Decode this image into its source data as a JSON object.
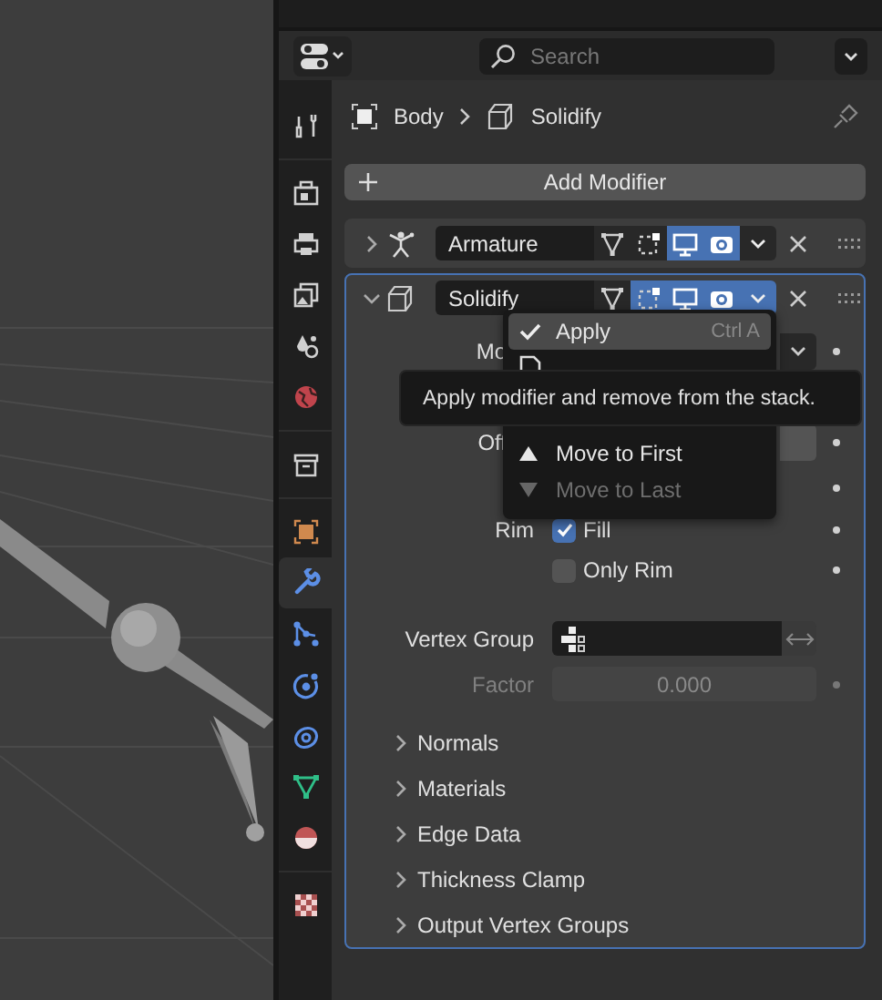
{
  "header": {
    "search": {
      "placeholder": "Search"
    }
  },
  "tab_groups": [
    {
      "tabs": [
        {
          "selected": false
        }
      ]
    },
    {
      "tabs": [
        {
          "selected": false
        },
        {
          "selected": false
        },
        {
          "selected": false
        },
        {
          "selected": false
        },
        {
          "selected": false
        }
      ]
    },
    {
      "tabs": [
        {
          "selected": false
        }
      ]
    },
    {
      "tabs": [
        {
          "selected": false
        },
        {
          "selected": true
        },
        {
          "selected": false
        },
        {
          "selected": false
        },
        {
          "selected": false
        },
        {
          "selected": false
        },
        {
          "selected": false
        }
      ]
    },
    {
      "tabs": [
        {
          "selected": false
        }
      ]
    }
  ],
  "breadcrumb": [
    {
      "label": "Body"
    },
    {
      "label": "Solidify"
    }
  ],
  "add_modifier": "Add Modifier",
  "modifiers": [
    {
      "name": "Armature",
      "kind": "armature",
      "expanded": false,
      "menu_open": false,
      "toggles": [
        {
          "on": false
        },
        {
          "on": false
        },
        {
          "on": true
        },
        {
          "on": true
        }
      ]
    },
    {
      "name": "Solidify",
      "kind": "solidify",
      "expanded": true,
      "menu_open": true,
      "toggles": [
        {
          "on": false
        },
        {
          "on": true
        },
        {
          "on": true
        },
        {
          "on": true
        }
      ],
      "rows": [
        {
          "kind": "dropdown",
          "label": "Mo"
        },
        {
          "kind": "field",
          "label": "Off"
        },
        {
          "kind": "covered"
        },
        {
          "kind": "checkbox",
          "label": "Rim",
          "text": "Fill",
          "checked": true
        },
        {
          "kind": "checkbox",
          "text": "Only Rim",
          "checked": false
        },
        {
          "kind": "vgroup",
          "label": "Vertex Group"
        },
        {
          "kind": "number",
          "label": "Factor",
          "value": "0.000",
          "disabled": true
        }
      ],
      "subpanels": [
        {
          "label": "Normals",
          "expanded": false
        },
        {
          "label": "Materials",
          "expanded": false
        },
        {
          "label": "Edge Data",
          "expanded": false
        },
        {
          "label": "Thickness Clamp",
          "expanded": false
        },
        {
          "label": "Output Vertex Groups",
          "expanded": false
        }
      ]
    }
  ],
  "context_menu": {
    "items": [
      {
        "label": "Apply",
        "shortcut": "Ctrl A",
        "kind": "check",
        "selected": true,
        "disabled": false
      },
      {
        "kind": "duplicate",
        "selected": false,
        "disabled": false
      },
      {
        "label": "Move to First",
        "kind": "up",
        "selected": false,
        "disabled": false
      },
      {
        "label": "Move to Last",
        "kind": "down",
        "selected": false,
        "disabled": true
      }
    ]
  },
  "tooltip": "Apply modifier and remove from the stack."
}
